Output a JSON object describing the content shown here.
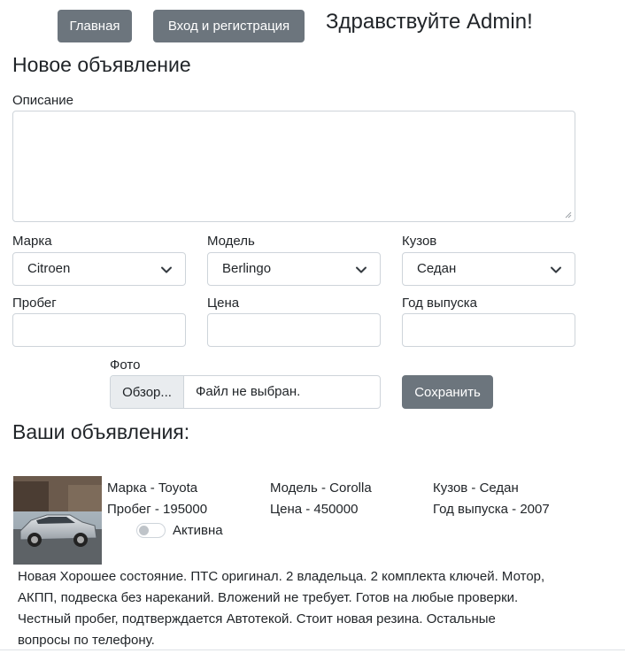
{
  "nav": {
    "home_label": "Главная",
    "login_label": "Вход и регистрация",
    "greeting": "Здравствуйте Admin!"
  },
  "form": {
    "title": "Новое объявление",
    "description_label": "Описание",
    "description_value": "",
    "make_label": "Марка",
    "make_value": "Citroen",
    "model_label": "Модель",
    "model_value": "Berlingo",
    "body_label": "Кузов",
    "body_value": "Седан",
    "mileage_label": "Пробег",
    "mileage_value": "",
    "price_label": "Цена",
    "price_value": "",
    "year_label": "Год выпуска",
    "year_value": "",
    "photo_label": "Фото",
    "browse_label": "Обзор...",
    "file_status": "Файл не выбран.",
    "save_label": "Сохранить"
  },
  "listings": {
    "title": "Ваши объявления:",
    "items": [
      {
        "make": "Марка - Toyota",
        "model": "Модель - Corolla",
        "body": "Кузов - Седан",
        "mileage": "Пробег - 195000",
        "price": "Цена - 450000",
        "year": "Год выпуска - 2007",
        "active_label": "Активна",
        "active": false,
        "description_lines": [
          "Новая Хорошее состояние. ПТС оригинал. 2 владельца. 2 комплекта ключей. Мотор,",
          "АКПП, подвеска без нареканий. Вложений не требует. Готов на любые проверки.",
          "Честный пробег, подтверждается Автотекой. Стоит новая резина. Остальные",
          "вопросы по телефону."
        ]
      }
    ]
  },
  "colors": {
    "button_bg": "#6c757d",
    "border": "#ced4da",
    "file_button_bg": "#e9ecef",
    "text": "#212529"
  }
}
